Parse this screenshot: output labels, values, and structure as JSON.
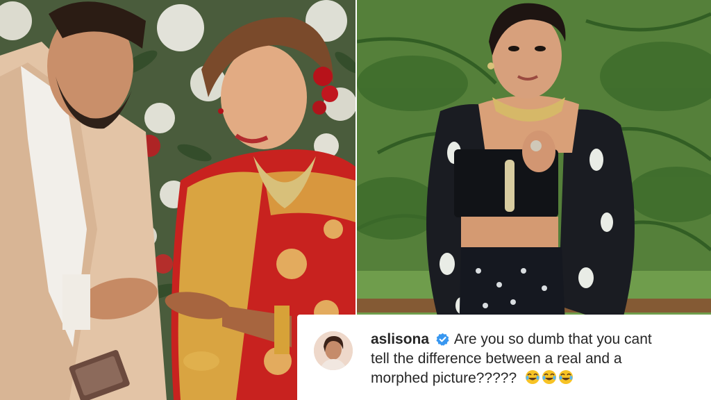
{
  "comment": {
    "username": "aslisona",
    "text_line1": "Are you so dumb that you cant",
    "text_line2": "tell the difference between a real and a",
    "text_line3": "morphed picture?????",
    "emoji": [
      "face-with-tears-of-joy-icon",
      "face-with-tears-of-joy-icon",
      "face-with-tears-of-joy-icon"
    ]
  },
  "colors": {
    "verified_badge": "#3897f0",
    "text": "#262626",
    "saree_red": "#c8221f",
    "gold": "#d9a441"
  }
}
